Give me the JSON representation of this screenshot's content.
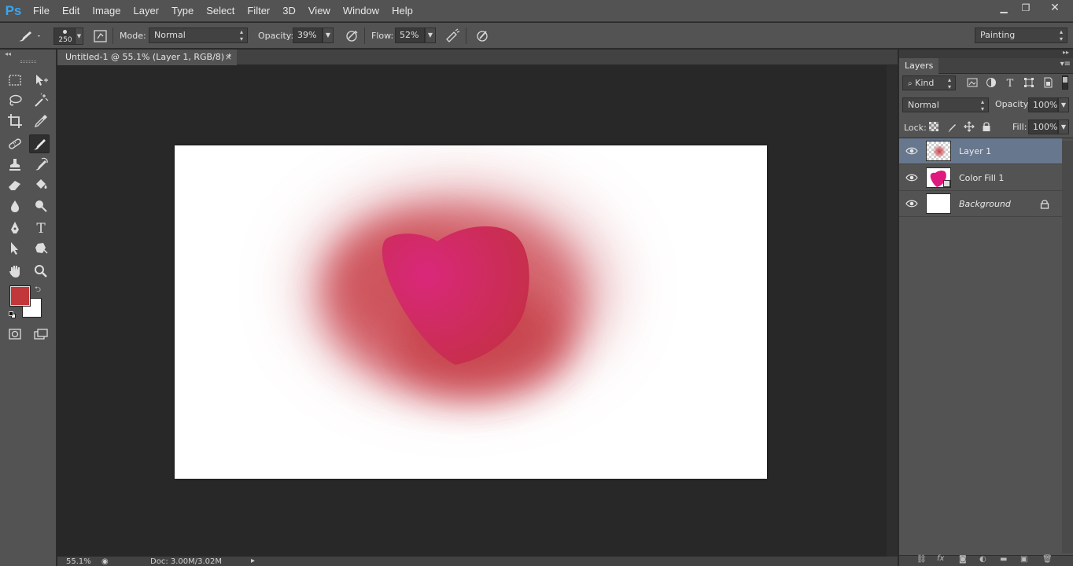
{
  "app": {
    "logo": "Ps"
  },
  "menu": [
    "File",
    "Edit",
    "Image",
    "Layer",
    "Type",
    "Select",
    "Filter",
    "3D",
    "View",
    "Window",
    "Help"
  ],
  "window_controls": {
    "minimize": "▁",
    "restore": "❐",
    "close": "✕"
  },
  "options": {
    "brush_size": "250",
    "mode_label": "Mode:",
    "mode_value": "Normal",
    "opacity_label": "Opacity:",
    "opacity_value": "39%",
    "flow_label": "Flow:",
    "flow_value": "52%",
    "workspace": "Painting"
  },
  "document": {
    "tab_title": "Untitled-1 @ 55.1% (Layer 1, RGB/8) *",
    "close": "×",
    "zoom": "55.1%",
    "doc_size": "Doc: 3.00M/3.02M"
  },
  "colors": {
    "foreground": "#c2373a",
    "background": "#ffffff",
    "heart": "#d12a6a",
    "glow": "#c8383e"
  },
  "layers_panel": {
    "tab": "Layers",
    "filter_kind": "Kind",
    "blend_mode": "Normal",
    "opacity_label": "Opacity:",
    "opacity_value": "100%",
    "lock_label": "Lock:",
    "fill_label": "Fill:",
    "fill_value": "100%",
    "layers": [
      {
        "name": "Layer 1",
        "selected": true,
        "thumb": "transparent-blur"
      },
      {
        "name": "Color Fill 1",
        "selected": false,
        "thumb": "heart-mask"
      },
      {
        "name": "Background",
        "selected": false,
        "thumb": "white",
        "locked": true
      }
    ]
  },
  "tools": [
    "rectangular-marquee-icon",
    "move-icon",
    "lasso-icon",
    "magic-wand-icon",
    "crop-icon",
    "eyedropper-icon",
    "healing-brush-icon",
    "brush-icon",
    "clone-stamp-icon",
    "history-brush-icon",
    "eraser-icon",
    "paint-bucket-icon",
    "blur-icon",
    "dodge-icon",
    "pen-icon",
    "type-icon",
    "path-selection-icon",
    "shape-icon",
    "hand-icon",
    "zoom-icon",
    "quick-mask-icon",
    "screen-mode-icon"
  ]
}
